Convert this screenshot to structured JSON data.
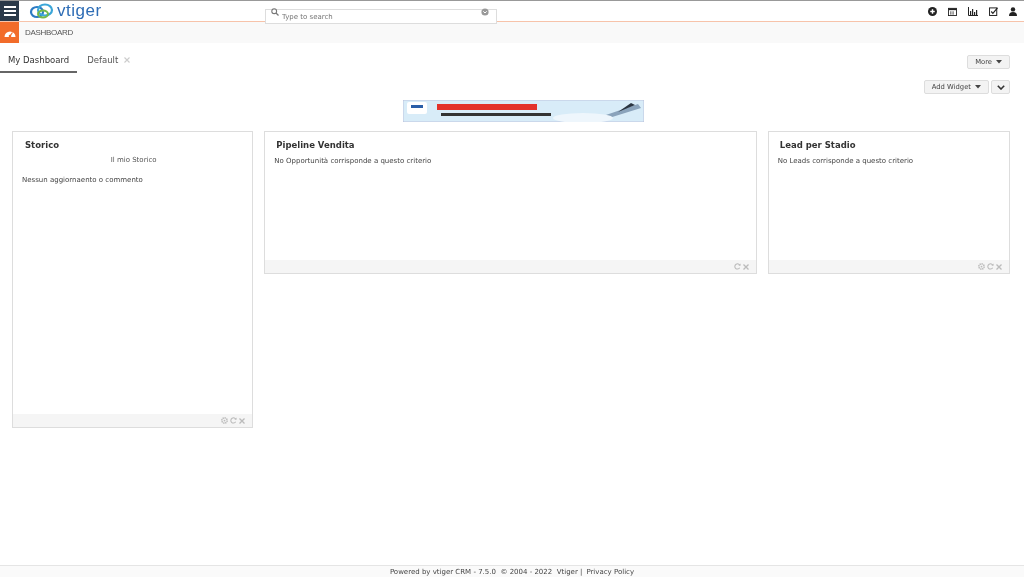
{
  "header": {
    "logo": "vtiger",
    "search": {
      "placeholder": "Type to search"
    }
  },
  "module": {
    "title": "DASHBOARD"
  },
  "tabs": [
    {
      "label": "My Dashboard",
      "selected": true,
      "closable": false
    },
    {
      "label": "Default",
      "selected": false,
      "closable": true
    }
  ],
  "buttons": {
    "more": "More",
    "add_widget": "Add Widget"
  },
  "widgets": [
    {
      "title": "Storico",
      "subtitle": "Il mio Storico",
      "message": "Nessun aggiornaento o commento",
      "controls": [
        {
          "kind": "settings"
        },
        {
          "kind": "refresh"
        },
        {
          "kind": "close"
        }
      ]
    },
    {
      "title": "Pipeline Vendita",
      "message": "No Opportunità corrisponde a questo criterio",
      "controls": [
        {
          "kind": "refresh"
        },
        {
          "kind": "close"
        }
      ]
    },
    {
      "title": "Lead per Stadio",
      "message": "No Leads corrisponde a questo criterio",
      "controls": [
        {
          "kind": "settings"
        },
        {
          "kind": "refresh"
        },
        {
          "kind": "close"
        }
      ]
    }
  ],
  "footer": {
    "text": "Powered by vtiger CRM - 7.5.0  © 2004 - 2022  Vtiger |",
    "link": "Privacy Policy"
  }
}
